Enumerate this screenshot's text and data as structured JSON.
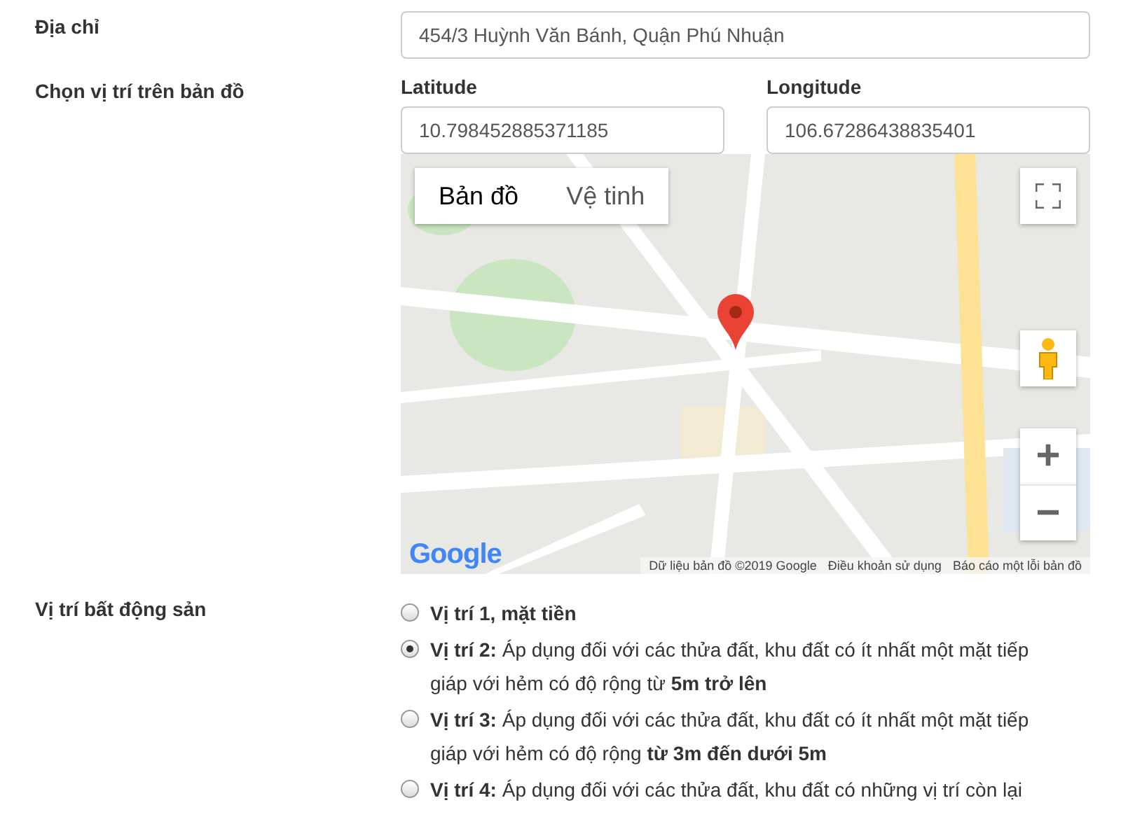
{
  "address": {
    "label": "Địa chỉ",
    "value": "454/3 Huỳnh Văn Bánh, Quận Phú Nhuận"
  },
  "location": {
    "label": "Chọn vị trí trên bản đồ",
    "latitude": {
      "label": "Latitude",
      "value": "10.798452885371185"
    },
    "longitude": {
      "label": "Longitude",
      "value": "106.67286438835401"
    },
    "map": {
      "types": [
        {
          "label": "Bản đồ",
          "selected": true
        },
        {
          "label": "Vệ tinh",
          "selected": false
        }
      ],
      "logo": "Google",
      "footer": [
        "Dữ liệu bản đồ ©2019 Google",
        "Điều khoản sử dụng",
        "Báo cáo một lỗi bản đồ"
      ],
      "zoom_in": "+",
      "zoom_out": "−"
    }
  },
  "position": {
    "label": "Vị trí bất động sản",
    "options": [
      {
        "title": "Vị trí 1, mặt tiền",
        "selected": false
      },
      {
        "title": "Vị trí 2:",
        "text": "Áp dụng đối với các thửa đất, khu đất có ít nhất một mặt tiếp giáp với hẻm có độ rộng từ **5m trở lên**",
        "selected": true
      },
      {
        "title": "Vị trí 3:",
        "text": "Áp dụng đối với các thửa đất, khu đất có ít nhất một mặt tiếp giáp với hẻm có độ rộng **từ 3m đến dưới 5m**",
        "selected": false
      },
      {
        "title": "Vị trí 4:",
        "text": "Áp dụng đối với các thửa đất, khu đất có những vị trí còn lại",
        "selected": false
      }
    ]
  }
}
